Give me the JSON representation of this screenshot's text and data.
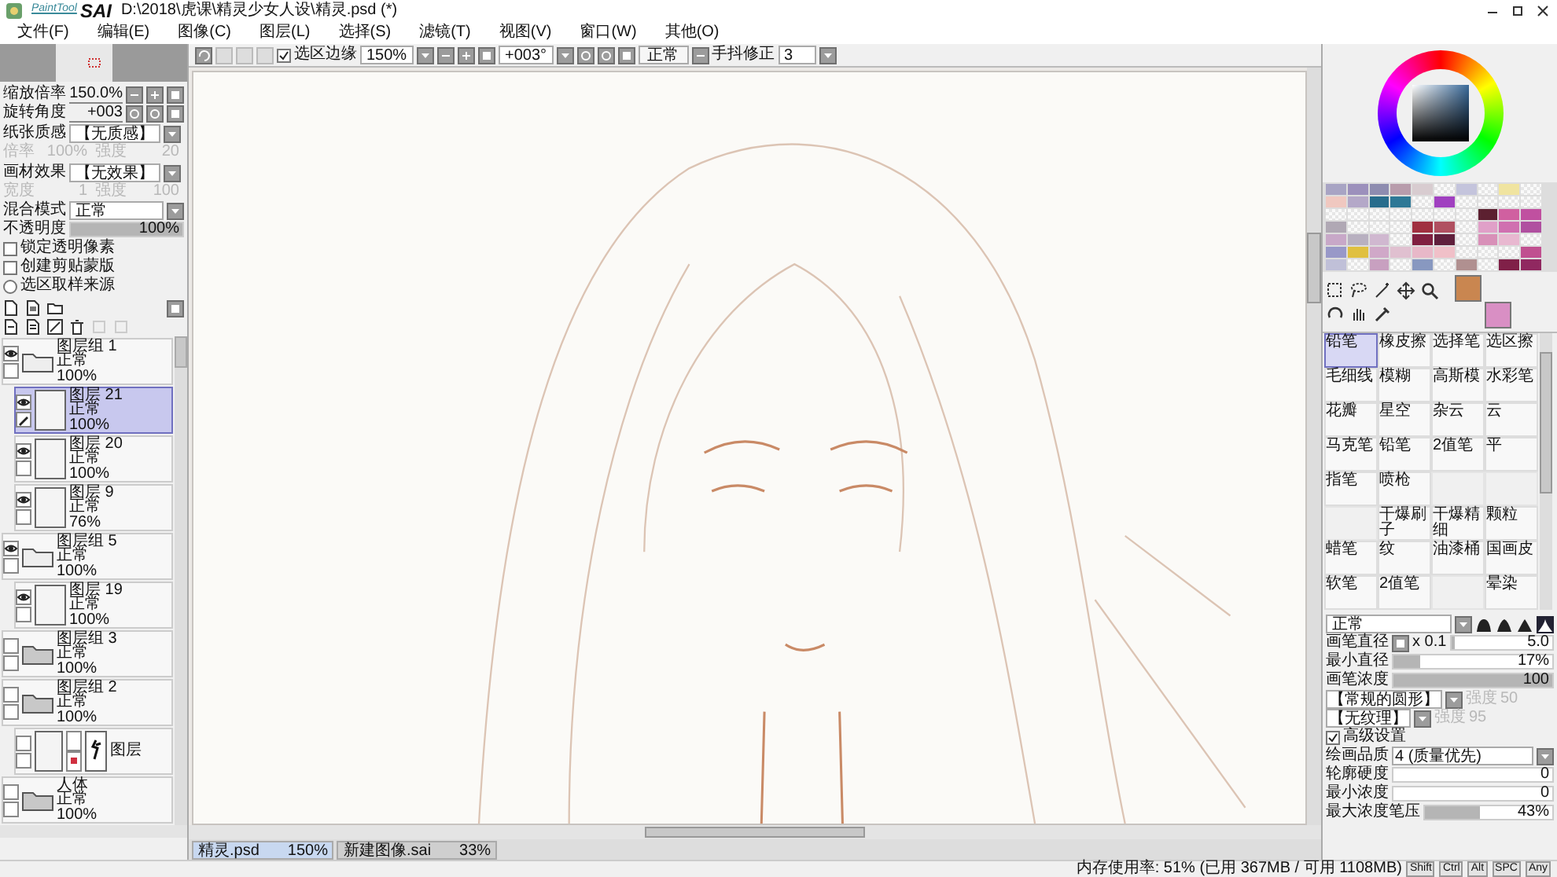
{
  "window": {
    "logo_small": "PaintTool",
    "logo_big": "SAI",
    "title": "D:\\2018\\虎课\\精灵少女人设\\精灵.psd (*)"
  },
  "menu": [
    "文件(F)",
    "编辑(E)",
    "图像(C)",
    "图层(L)",
    "选择(S)",
    "滤镜(T)",
    "视图(V)",
    "窗口(W)",
    "其他(O)"
  ],
  "toolbar": {
    "selection_edge": {
      "label": "选区边缘",
      "checked": true
    },
    "zoom": "150%",
    "rotation": "+003°",
    "blend": "正常",
    "stabilizer_label": "手抖修正",
    "stabilizer": "3"
  },
  "navigator": {
    "rows": [
      {
        "label": "缩放倍率",
        "value": "150.0%"
      },
      {
        "label": "旋转角度",
        "value": "+003"
      }
    ]
  },
  "layer_props": {
    "textures": [
      {
        "label": "纸张质感",
        "value": "【无质感】",
        "params": [
          {
            "label": "倍率",
            "value": "100%"
          },
          {
            "label": "强度",
            "value": "20"
          }
        ]
      },
      {
        "label": "画材效果",
        "value": "【无效果】",
        "params": [
          {
            "label": "宽度",
            "value": "1"
          },
          {
            "label": "强度",
            "value": "100"
          }
        ]
      }
    ],
    "blend_label": "混合模式",
    "blend": "正常",
    "opacity": {
      "label": "不透明度",
      "reading": "100%",
      "level": 1
    },
    "options": [
      {
        "kind": "checkbox",
        "label": "锁定透明像素",
        "checked": false
      },
      {
        "kind": "checkbox",
        "label": "创建剪贴蒙版",
        "checked": false
      },
      {
        "kind": "radio",
        "label": "选区取样来源",
        "checked": false
      }
    ]
  },
  "layers": [
    {
      "kind": "folder",
      "name": "图层组 1",
      "mode": "正常",
      "opacity": "100%",
      "visible": true,
      "selected": false,
      "children": [
        {
          "kind": "layer",
          "name": "图层 21",
          "mode": "正常",
          "opacity": "100%",
          "visible": true,
          "selected": true
        },
        {
          "kind": "layer",
          "name": "图层 20",
          "mode": "正常",
          "opacity": "100%",
          "visible": true,
          "selected": false
        },
        {
          "kind": "layer",
          "name": "图层 9",
          "mode": "正常",
          "opacity": "76%",
          "visible": true,
          "selected": false
        }
      ]
    },
    {
      "kind": "folder",
      "name": "图层组 5",
      "mode": "正常",
      "opacity": "100%",
      "visible": true,
      "selected": false,
      "children": [
        {
          "kind": "layer",
          "name": "图层 19",
          "mode": "正常",
          "opacity": "100%",
          "visible": true,
          "selected": false
        }
      ]
    },
    {
      "kind": "folder",
      "name": "图层组 3",
      "mode": "正常",
      "opacity": "100%",
      "visible": false,
      "selected": false
    },
    {
      "kind": "folder",
      "name": "图层组 2",
      "mode": "正常",
      "opacity": "100%",
      "visible": false,
      "selected": false,
      "children": [
        {
          "kind": "masked",
          "name": "图层",
          "visible": false,
          "selected": false
        }
      ]
    },
    {
      "kind": "folder",
      "name": "人体",
      "mode": "正常",
      "opacity": "100%",
      "visible": false,
      "selected": false
    }
  ],
  "color_slots": [
    {
      "color": "#c98650"
    },
    {
      "color": "#d98fc4"
    }
  ],
  "swatches": [
    [
      {
        "color": "#a8a4c4"
      },
      {
        "color": "#9c90bc"
      },
      {
        "color": "#8e8cb0"
      },
      {
        "color": "#b89cac"
      },
      {
        "color": "#d8ccd0"
      },
      {
        "kind": "empty"
      },
      {
        "color": "#c4c4dc"
      },
      {
        "kind": "empty"
      },
      {
        "color": "#f0e4a0"
      },
      {
        "kind": "empty"
      }
    ],
    [
      {
        "color": "#f0c8c0"
      },
      {
        "color": "#b4a8c8"
      },
      {
        "color": "#286c8c"
      },
      {
        "color": "#2e7896"
      },
      {
        "kind": "empty"
      },
      {
        "color": "#a040c0"
      },
      {
        "kind": "empty"
      },
      {
        "kind": "empty"
      },
      {
        "kind": "empty"
      },
      {
        "kind": "empty"
      }
    ],
    [
      {
        "kind": "empty"
      },
      {
        "kind": "empty"
      },
      {
        "kind": "empty"
      },
      {
        "kind": "empty"
      },
      {
        "kind": "empty"
      },
      {
        "kind": "empty"
      },
      {
        "kind": "empty"
      },
      {
        "color": "#5c2030"
      },
      {
        "color": "#d060a0"
      },
      {
        "color": "#c050a0"
      }
    ],
    [
      {
        "color": "#b0a8b4"
      },
      {
        "kind": "empty"
      },
      {
        "kind": "empty"
      },
      {
        "kind": "empty"
      },
      {
        "color": "#a03040"
      },
      {
        "color": "#b05060"
      },
      {
        "kind": "empty"
      },
      {
        "color": "#e0a0c8"
      },
      {
        "color": "#d070b0"
      },
      {
        "color": "#b050a0"
      }
    ],
    [
      {
        "color": "#c8a8c8"
      },
      {
        "color": "#b8b0c0"
      },
      {
        "color": "#d0b8d0"
      },
      {
        "kind": "empty"
      },
      {
        "color": "#802040"
      },
      {
        "color": "#60203c"
      },
      {
        "kind": "empty"
      },
      {
        "color": "#d890b8"
      },
      {
        "color": "#e8b8d0"
      },
      {
        "kind": "empty"
      }
    ],
    [
      {
        "color": "#9898c8"
      },
      {
        "color": "#e0c040"
      },
      {
        "color": "#d0a8c8"
      },
      {
        "color": "#e0c0d0"
      },
      {
        "color": "#e8b8c8"
      },
      {
        "color": "#f0c0c8"
      },
      {
        "kind": "empty"
      },
      {
        "kind": "empty"
      },
      {
        "kind": "empty"
      },
      {
        "color": "#c05090"
      }
    ],
    [
      {
        "color": "#c0c0d8"
      },
      {
        "kind": "empty"
      },
      {
        "color": "#c8a0c0"
      },
      {
        "kind": "empty"
      },
      {
        "color": "#8898c0"
      },
      {
        "kind": "empty"
      },
      {
        "color": "#b09090"
      },
      {
        "kind": "empty"
      },
      {
        "color": "#802048"
      },
      {
        "color": "#902860"
      }
    ]
  ],
  "tools": [
    {
      "kind": "tool",
      "label": "铅笔",
      "selected": true
    },
    {
      "kind": "tool",
      "label": "橡皮擦",
      "selected": false
    },
    {
      "kind": "tool",
      "label": "选择笔",
      "selected": false
    },
    {
      "kind": "tool",
      "label": "选区擦",
      "selected": false
    },
    {
      "kind": "tool",
      "label": "毛细线",
      "selected": false
    },
    {
      "kind": "tool",
      "label": "模糊",
      "selected": false
    },
    {
      "kind": "tool",
      "label": "高斯模",
      "selected": false
    },
    {
      "kind": "tool",
      "label": "水彩笔",
      "selected": false
    },
    {
      "kind": "tool",
      "label": "花瓣",
      "selected": false
    },
    {
      "kind": "tool",
      "label": "星空",
      "selected": false
    },
    {
      "kind": "tool",
      "label": "杂云",
      "selected": false
    },
    {
      "kind": "tool",
      "label": "云",
      "selected": false
    },
    {
      "kind": "tool",
      "label": "马克笔",
      "selected": false
    },
    {
      "kind": "tool",
      "label": "铅笔",
      "selected": false
    },
    {
      "kind": "tool",
      "label": "2值笔",
      "selected": false
    },
    {
      "kind": "tool",
      "label": "平",
      "selected": false
    },
    {
      "kind": "tool",
      "label": "指笔",
      "selected": false
    },
    {
      "kind": "tool",
      "label": "喷枪",
      "selected": false
    },
    {
      "kind": "empty"
    },
    {
      "kind": "empty"
    },
    {
      "kind": "empty"
    },
    {
      "kind": "tool",
      "label": "干爆刷子",
      "selected": false
    },
    {
      "kind": "tool",
      "label": "干爆精细",
      "selected": false
    },
    {
      "kind": "tool",
      "label": "颗粒",
      "selected": false
    },
    {
      "kind": "tool",
      "label": "蜡笔",
      "selected": false
    },
    {
      "kind": "tool",
      "label": "纹",
      "selected": false
    },
    {
      "kind": "tool",
      "label": "油漆桶",
      "selected": false
    },
    {
      "kind": "tool",
      "label": "国画皮",
      "selected": false
    },
    {
      "kind": "tool",
      "label": "软笔",
      "selected": false
    },
    {
      "kind": "tool",
      "label": "2值笔",
      "selected": false
    },
    {
      "kind": "empty"
    },
    {
      "kind": "tool",
      "label": "晕染",
      "selected": false
    }
  ],
  "brush": {
    "blend": "正常",
    "tip_shapes": [
      {
        "selected": false
      },
      {
        "selected": false
      },
      {
        "selected": false
      },
      {
        "selected": true
      }
    ],
    "rows": [
      {
        "kind": "size",
        "label": "画笔直径",
        "multiplier": "x 0.1",
        "reading": "5.0",
        "level": 0.03
      },
      {
        "kind": "slider",
        "label": "最小直径",
        "reading": "17%",
        "level": 0.17
      },
      {
        "kind": "slider",
        "label": "画笔浓度",
        "reading": "100",
        "level": 1
      },
      {
        "kind": "select",
        "value": "【常规的圆形】",
        "param_label": "强度",
        "param": "50"
      },
      {
        "kind": "select",
        "value": "【无纹理】",
        "param_label": "强度",
        "param": "95"
      },
      {
        "kind": "checkbox",
        "label": "高级设置",
        "checked": true
      },
      {
        "kind": "quality",
        "label": "绘画品质",
        "value": "4 (质量优先)"
      },
      {
        "kind": "slider",
        "label": "轮廓硬度",
        "reading": "0",
        "level": 0
      },
      {
        "kind": "slider",
        "label": "最小浓度",
        "reading": "0",
        "level": 0
      },
      {
        "kind": "slider",
        "label": "最大浓度笔压",
        "reading": "43%",
        "level": 0.43
      }
    ]
  },
  "documents": [
    {
      "name": "精灵.psd",
      "zoom": "150%",
      "selected": true
    },
    {
      "name": "新建图像.sai",
      "zoom": "33%",
      "selected": false
    }
  ],
  "status": {
    "memory": "内存使用率: 51% (已用 367MB / 可用 1108MB)",
    "keys": [
      "Shift",
      "Ctrl",
      "Alt",
      "SPC",
      "Any"
    ]
  }
}
